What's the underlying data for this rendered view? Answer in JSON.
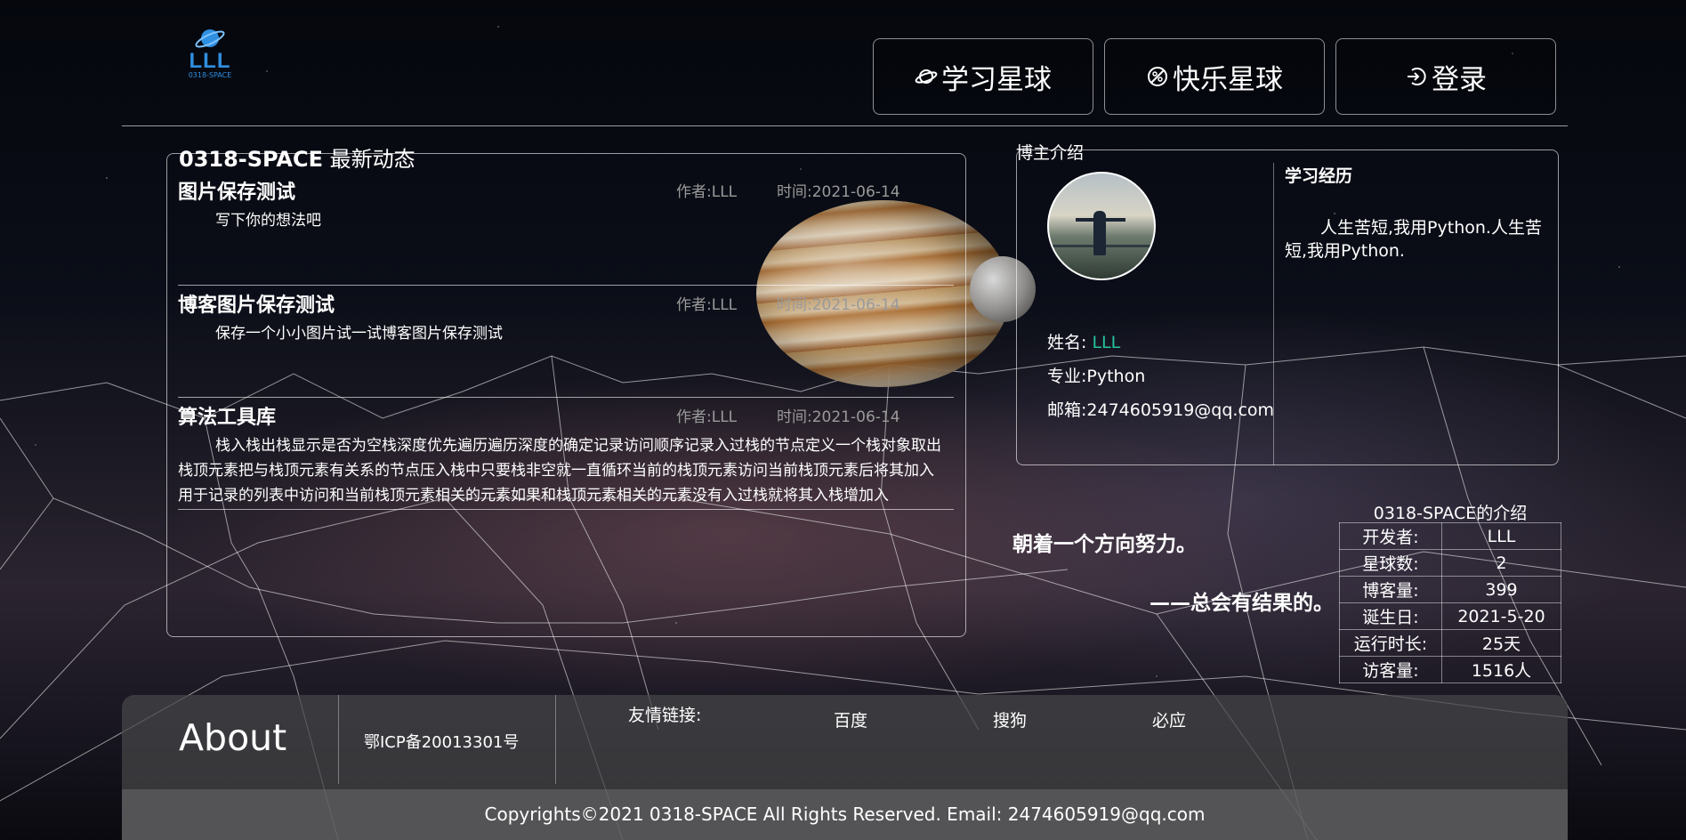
{
  "logo": {
    "text": "LLL",
    "subtext": "0318-SPACE"
  },
  "nav": {
    "items": [
      {
        "label": "学习星球",
        "icon": "planet-icon"
      },
      {
        "label": "快乐星球",
        "icon": "no-entry-planet-icon"
      },
      {
        "label": "登录",
        "icon": "login-icon"
      }
    ]
  },
  "news": {
    "title_brand": "0318-SPACE",
    "title_rest": " 最新动态",
    "posts": [
      {
        "title": "图片保存测试",
        "author": "作者:LLL",
        "time": "时间:2021-06-14",
        "body": "写下你的想法吧"
      },
      {
        "title": "博客图片保存测试",
        "author": "作者:LLL",
        "time": "时间:2021-06-14",
        "body": "保存一个小小图片试一试博客图片保存测试"
      },
      {
        "title": "算法工具库",
        "author": "作者:LLL",
        "time": "时间:2021-06-14",
        "body": "栈入栈出栈显示是否为空栈深度优先遍历遍历深度的确定记录访问顺序记录入过栈的节点定义一个栈对象取出栈顶元素把与栈顶元素有关系的节点压入栈中只要栈非空就一直循环当前的栈顶元素访问当前栈顶元素后将其加入用于记录的列表中访问和当前栈顶元素相关的元素如果和栈顶元素相关的元素没有入过栈就将其入栈增加入"
      }
    ]
  },
  "bio": {
    "legend": "博主介绍",
    "name_label": "姓名: ",
    "name_value": "LLL",
    "major": "专业:Python",
    "email": "邮箱:2474605919@qq.com",
    "exp_title": "学习经历",
    "exp_body": "人生苦短,我用Python.人生苦短,我用Python."
  },
  "quotes": {
    "line1": "朝着一个方向努力。",
    "line2": "——总会有结果的。"
  },
  "stats": {
    "caption": "0318-SPACE的介绍",
    "rows": [
      {
        "k": "开发者:",
        "v": "LLL"
      },
      {
        "k": "星球数:",
        "v": "2"
      },
      {
        "k": "博客量:",
        "v": "399"
      },
      {
        "k": "诞生日:",
        "v": "2021-5-20"
      },
      {
        "k": "运行时长:",
        "v": "25天"
      },
      {
        "k": "访客量:",
        "v": "1516人"
      }
    ]
  },
  "footer": {
    "about": "About",
    "icp": "鄂ICP备20013301号",
    "links_label": "友情链接:",
    "links": [
      "百度",
      "搜狗",
      "必应"
    ],
    "copyright": "Copyrights©2021 0318-SPACE All Rights Reserved. Email: 2474605919@qq.com"
  },
  "colors": {
    "accent_green": "#25c2a0",
    "logo_blue": "#2f8fe0",
    "muted_text": "#9a9a9a"
  }
}
